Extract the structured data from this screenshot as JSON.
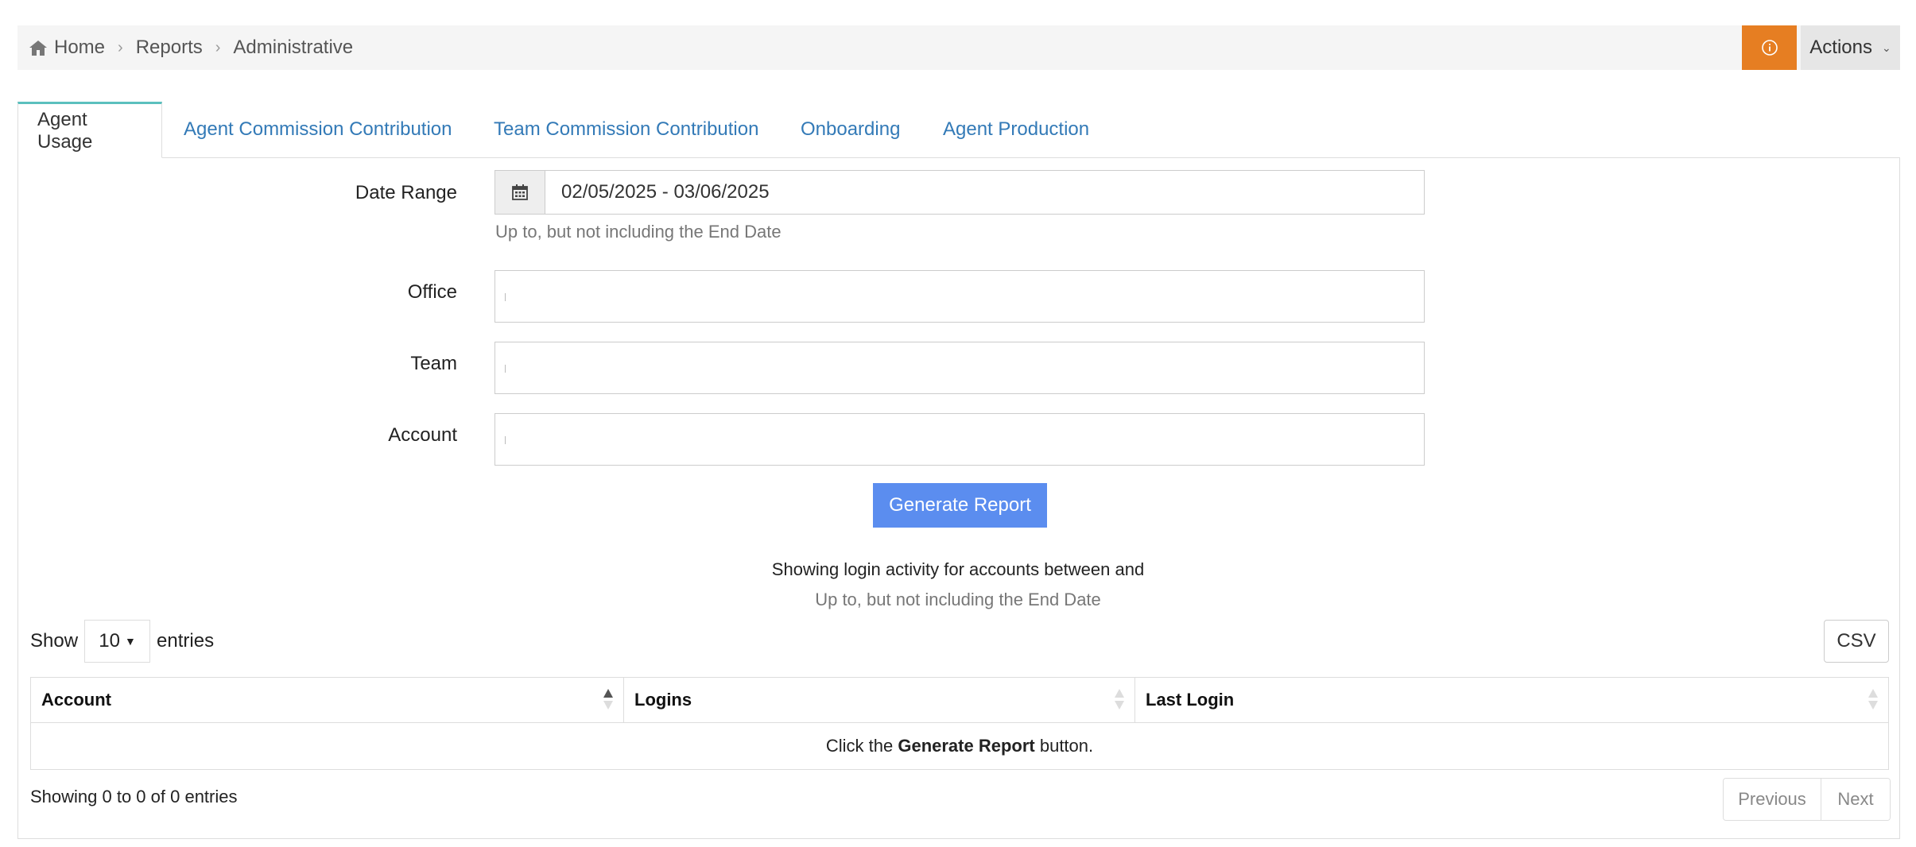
{
  "breadcrumb": {
    "home": "Home",
    "reports": "Reports",
    "current": "Administrative"
  },
  "header": {
    "actions_label": "Actions",
    "info_icon": "info-circle-icon",
    "accent": "#e67e22"
  },
  "tabs": [
    {
      "label": "Agent Usage",
      "active": true
    },
    {
      "label": "Agent Commission Contribution"
    },
    {
      "label": "Team Commission Contribution"
    },
    {
      "label": "Onboarding"
    },
    {
      "label": "Agent Production"
    }
  ],
  "form": {
    "date_range_label": "Date Range",
    "date_range_value": "02/05/2025 - 03/06/2025",
    "date_range_help": "Up to, but not including the End Date",
    "office_label": "Office",
    "team_label": "Team",
    "account_label": "Account",
    "generate_label": "Generate Report",
    "generate_color": "#5b8def"
  },
  "status": {
    "line1": "Showing login activity for accounts between and",
    "line2": "Up to, but not including the End Date"
  },
  "table_controls": {
    "show_label": "Show",
    "page_length": "10",
    "entries_label": "entries",
    "csv_label": "CSV"
  },
  "table": {
    "columns": [
      "Account",
      "Logins",
      "Last Login"
    ],
    "empty_prefix": "Click the ",
    "empty_strong": "Generate Report",
    "empty_suffix": " button."
  },
  "footer": {
    "info": "Showing 0 to 0 of 0 entries",
    "previous": "Previous",
    "next": "Next"
  }
}
